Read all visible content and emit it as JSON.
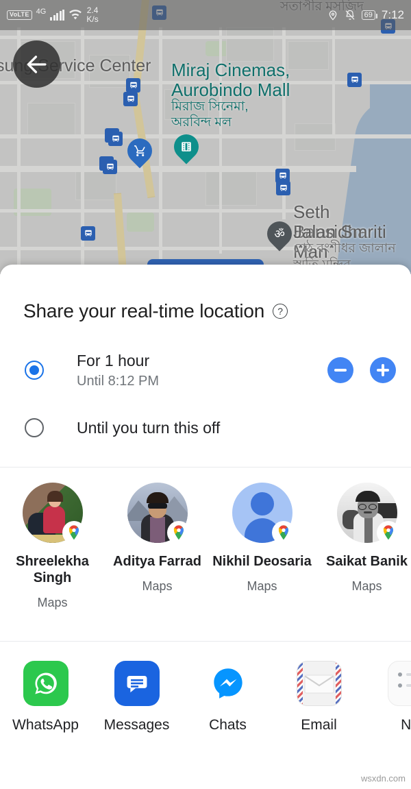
{
  "status_bar": {
    "volte": "VoLTE",
    "network": "4G",
    "data_rate": "2.4",
    "data_unit": "K/s",
    "battery": "69",
    "time": "7:12"
  },
  "map": {
    "back_button": "back-arrow",
    "labels": [
      {
        "text": "sung Service Center",
        "type": "place"
      },
      {
        "text": "Miraj Cinemas,",
        "type": "poi"
      },
      {
        "text": "Aurobindo Mall",
        "type": "poi"
      },
      {
        "text": "মিরাজ সিনেমা,",
        "type": "poi-native"
      },
      {
        "text": "অরবিন্দ মল",
        "type": "poi-native"
      },
      {
        "text": "সতাপীর মসজিদ",
        "type": "place-native"
      },
      {
        "text": "Seth Bansidhar",
        "type": "place"
      },
      {
        "text": "Jalan Smriti Man",
        "type": "place"
      },
      {
        "text": "শেঠ বংশীধর জালান",
        "type": "place-native"
      },
      {
        "text": "স্মৃতি মন্দির",
        "type": "place-native"
      }
    ],
    "markers": [
      "bus-station-icon",
      "bus-station-icon",
      "bus-station-icon",
      "bus-station-icon",
      "bus-station-icon",
      "bus-station-icon",
      "bus-station-icon",
      "bus-station-icon",
      "bus-station-icon",
      "shopping-cart-pin-icon",
      "cinema-pin-icon",
      "temple-pin-icon"
    ],
    "colors": {
      "land": "#d3d4d2",
      "water": "#9fb6cd",
      "park": "#c8d8c0",
      "major_road": "#e6d6a0",
      "poi_label": "#0f6f6a",
      "marker_blue": "#2b5fb0",
      "marker_teal": "#0f8c8c"
    }
  },
  "sheet": {
    "title": "Share your real-time location",
    "help_icon": "?",
    "options": [
      {
        "id": "for-1-hour",
        "label": "For 1 hour",
        "sub": "Until 8:12 PM",
        "selected": true,
        "has_steppers": true,
        "decrease_label": "−",
        "increase_label": "+"
      },
      {
        "id": "until-turn-off",
        "label": "Until you turn this off",
        "sub": "",
        "selected": false,
        "has_steppers": false
      }
    ],
    "accent_color": "#1a73e8",
    "stepper_color": "#4285f4"
  },
  "contacts": [
    {
      "name": "Shreelekha Singh",
      "app": "Maps",
      "avatar": "photo",
      "badge": "google-maps-pin-icon"
    },
    {
      "name": "Aditya Farrad",
      "app": "Maps",
      "avatar": "photo",
      "badge": "google-maps-pin-icon"
    },
    {
      "name": "Nikhil Deosaria",
      "app": "Maps",
      "avatar": "default-person",
      "badge": "google-maps-pin-icon"
    },
    {
      "name": "Saikat Banik",
      "app": "Maps",
      "avatar": "photo-bw",
      "badge": "google-maps-pin-icon"
    }
  ],
  "apps": [
    {
      "name": "WhatsApp",
      "icon": "whatsapp-icon",
      "color": "#25d366"
    },
    {
      "name": "Messages",
      "icon": "messages-icon",
      "color": "#1a73e8"
    },
    {
      "name": "Chats",
      "icon": "messenger-icon",
      "color": "#0695ff"
    },
    {
      "name": "Email",
      "icon": "email-icon",
      "color": "#f1f1f1"
    },
    {
      "name": "No",
      "icon": "notes-icon",
      "color": "#f5f5f5"
    }
  ],
  "watermark": "wsxdn.com"
}
